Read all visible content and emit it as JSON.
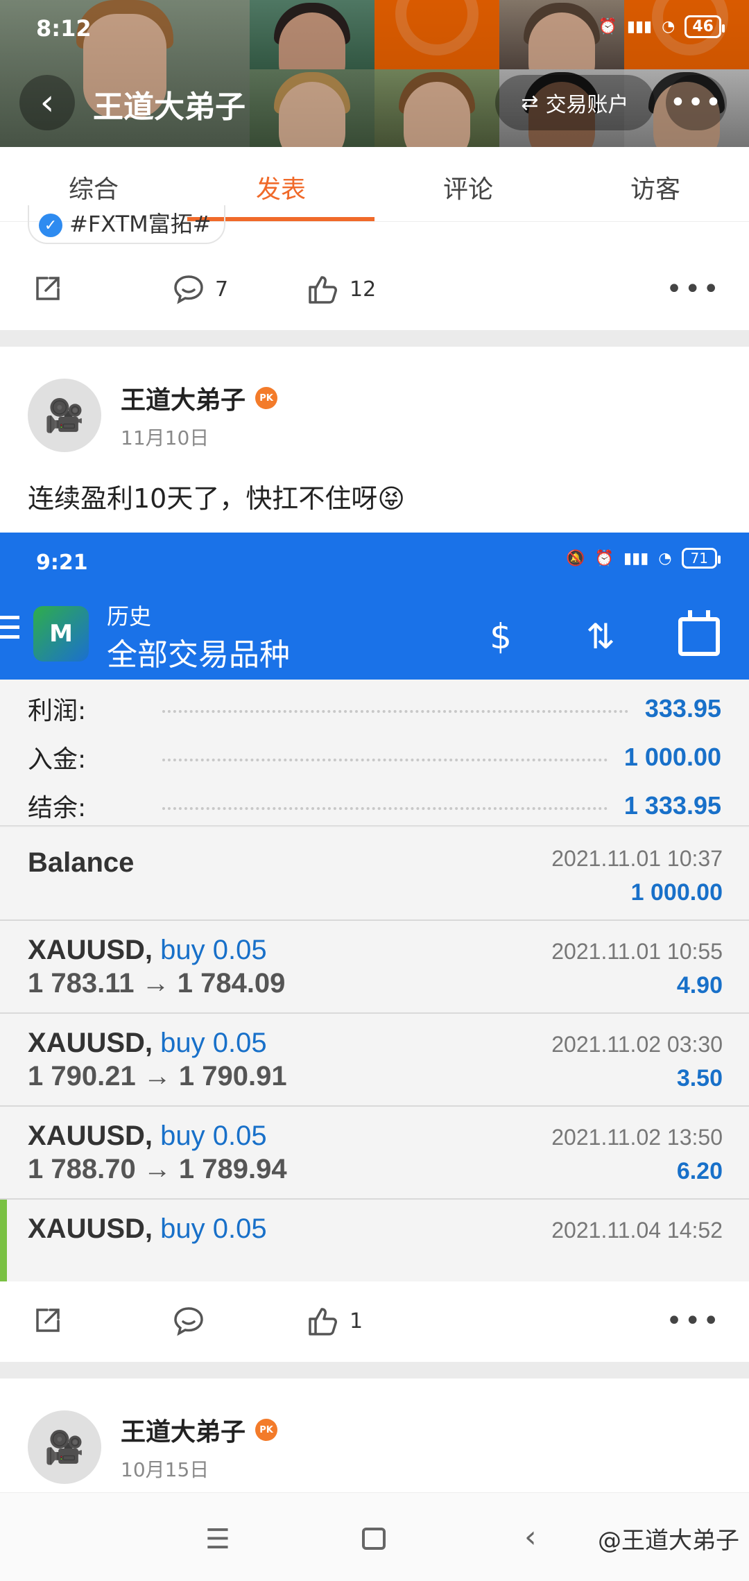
{
  "status_bar": {
    "time": "8:12",
    "battery": "46"
  },
  "header": {
    "title": "王道大弟子",
    "account_button": "交易账户"
  },
  "tabs": [
    "综合",
    "发表",
    "评论",
    "访客"
  ],
  "post1": {
    "tag": "#FXTM富拓#",
    "actions": {
      "comments": "7",
      "likes": "12"
    }
  },
  "post2": {
    "author": "王道大弟子",
    "badge": "PK",
    "date": "11月10日",
    "text": "连续盈利10天了，快扛不住呀😝",
    "actions": {
      "comments": "",
      "likes": "1"
    }
  },
  "screenshot": {
    "status": {
      "time": "9:21",
      "battery": "71"
    },
    "subtitle": "历史",
    "title": "全部交易品种",
    "summary": [
      {
        "label": "利润:",
        "value": "333.95"
      },
      {
        "label": "入金:",
        "value": "1 000.00"
      },
      {
        "label": "结余:",
        "value": "1 333.95"
      }
    ],
    "balance": {
      "label": "Balance",
      "datetime": "2021.11.01 10:37",
      "amount": "1 000.00"
    },
    "deals": [
      {
        "symbol": "XAUUSD,",
        "side": "buy 0.05",
        "prices": "1 783.11 → 1 784.09",
        "datetime": "2021.11.01 10:55",
        "profit": "4.90"
      },
      {
        "symbol": "XAUUSD,",
        "side": "buy 0.05",
        "prices": "1 790.21 → 1 790.91",
        "datetime": "2021.11.02 03:30",
        "profit": "3.50"
      },
      {
        "symbol": "XAUUSD,",
        "side": "buy 0.05",
        "prices": "1 788.70 → 1 789.94",
        "datetime": "2021.11.02 13:50",
        "profit": "6.20"
      },
      {
        "symbol": "XAUUSD,",
        "side": "buy 0.05",
        "prices": "",
        "datetime": "2021.11.04 14:52",
        "profit": ""
      }
    ]
  },
  "post3": {
    "author": "王道大弟子",
    "badge": "PK",
    "date": "10月15日"
  },
  "watermark": "@王道大弟子",
  "colors": {
    "accent": "#f06a2a",
    "mt_blue": "#1a72e8",
    "value_blue": "#1870c9"
  }
}
